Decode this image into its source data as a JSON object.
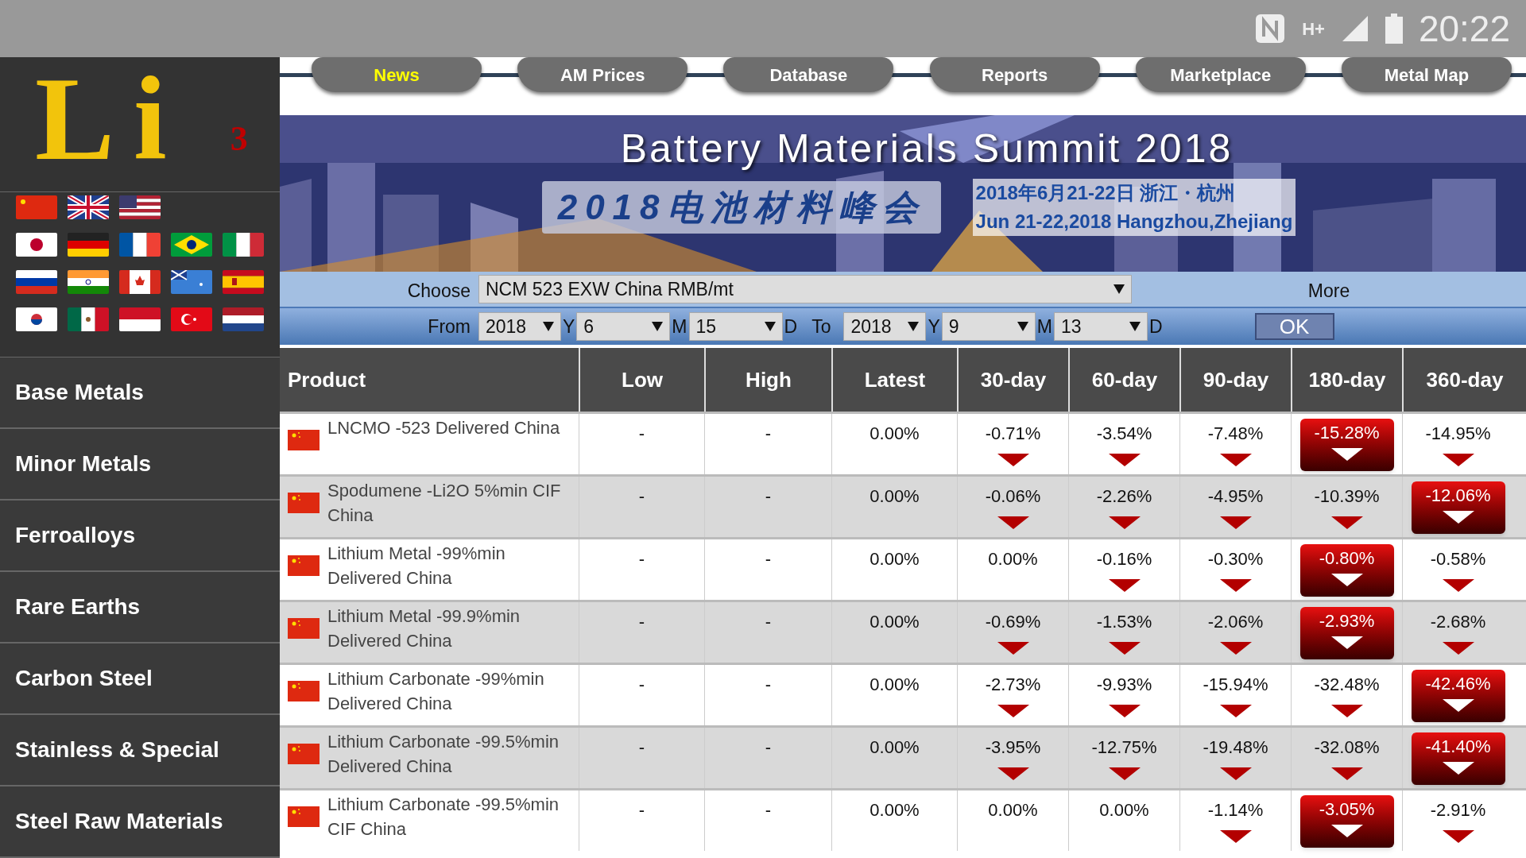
{
  "status_bar": {
    "network_type": "H+",
    "time": "20:22"
  },
  "logo": {
    "symbol": "Li",
    "number": "3"
  },
  "sidebar": {
    "items": [
      {
        "label": "Base Metals"
      },
      {
        "label": "Minor Metals"
      },
      {
        "label": "Ferroalloys"
      },
      {
        "label": "Rare Earths"
      },
      {
        "label": "Carbon Steel"
      },
      {
        "label": "Stainless & Special"
      },
      {
        "label": "Steel Raw Materials"
      }
    ]
  },
  "nav_tabs": [
    {
      "label": "News",
      "selected": true
    },
    {
      "label": "AM Prices",
      "selected": false
    },
    {
      "label": "Database",
      "selected": false
    },
    {
      "label": "Reports",
      "selected": false
    },
    {
      "label": "Marketplace",
      "selected": false
    },
    {
      "label": "Metal Map",
      "selected": false
    }
  ],
  "banner": {
    "title": "Battery Materials Summit 2018",
    "subtitle": "2018电池材料峰会",
    "date_cn": "2018年6月21-22日  浙江・杭州",
    "date_en": "Jun 21-22,2018  Hangzhou,Zhejiang"
  },
  "filter": {
    "choose_label": "Choose",
    "product_value": "NCM 523 EXW China RMB/mt",
    "more": "More",
    "from_label": "From",
    "to_label": "To",
    "from": [
      {
        "value": "2018",
        "unit": "Y"
      },
      {
        "value": "6",
        "unit": "M"
      },
      {
        "value": "15",
        "unit": "D"
      }
    ],
    "to": [
      {
        "value": "2018",
        "unit": "Y"
      },
      {
        "value": "9",
        "unit": "M"
      },
      {
        "value": "13",
        "unit": "D"
      }
    ],
    "ok": "OK"
  },
  "table": {
    "columns": [
      "Product",
      "Low",
      "High",
      "Latest",
      "30-day",
      "60-day",
      "90-day",
      "180-day",
      "360-day"
    ],
    "rows": [
      {
        "product": "LNCMO -523 Delivered China",
        "low": "-",
        "high": "-",
        "latest": "0.00%",
        "changes": [
          {
            "value": "-0.71%",
            "highlight": false,
            "down_arrow": true
          },
          {
            "value": "-3.54%",
            "highlight": false,
            "down_arrow": true
          },
          {
            "value": "-7.48%",
            "highlight": false,
            "down_arrow": true
          },
          {
            "value": "-15.28%",
            "highlight": true,
            "down_arrow": true
          },
          {
            "value": "-14.95%",
            "highlight": false,
            "down_arrow": true
          }
        ]
      },
      {
        "product": "Spodumene -Li2O 5%min CIF China",
        "low": "-",
        "high": "-",
        "latest": "0.00%",
        "changes": [
          {
            "value": "-0.06%",
            "highlight": false,
            "down_arrow": true
          },
          {
            "value": "-2.26%",
            "highlight": false,
            "down_arrow": true
          },
          {
            "value": "-4.95%",
            "highlight": false,
            "down_arrow": true
          },
          {
            "value": "-10.39%",
            "highlight": false,
            "down_arrow": true
          },
          {
            "value": "-12.06%",
            "highlight": true,
            "down_arrow": true
          }
        ]
      },
      {
        "product": "Lithium Metal -99%min Delivered China",
        "low": "-",
        "high": "-",
        "latest": "0.00%",
        "changes": [
          {
            "value": "0.00%",
            "highlight": false,
            "down_arrow": false
          },
          {
            "value": "-0.16%",
            "highlight": false,
            "down_arrow": true
          },
          {
            "value": "-0.30%",
            "highlight": false,
            "down_arrow": true
          },
          {
            "value": "-0.80%",
            "highlight": true,
            "down_arrow": true
          },
          {
            "value": "-0.58%",
            "highlight": false,
            "down_arrow": true
          }
        ]
      },
      {
        "product": "Lithium Metal -99.9%min Delivered China",
        "low": "-",
        "high": "-",
        "latest": "0.00%",
        "changes": [
          {
            "value": "-0.69%",
            "highlight": false,
            "down_arrow": true
          },
          {
            "value": "-1.53%",
            "highlight": false,
            "down_arrow": true
          },
          {
            "value": "-2.06%",
            "highlight": false,
            "down_arrow": true
          },
          {
            "value": "-2.93%",
            "highlight": true,
            "down_arrow": true
          },
          {
            "value": "-2.68%",
            "highlight": false,
            "down_arrow": true
          }
        ]
      },
      {
        "product": "Lithium Carbonate -99%min Delivered China",
        "low": "-",
        "high": "-",
        "latest": "0.00%",
        "changes": [
          {
            "value": "-2.73%",
            "highlight": false,
            "down_arrow": true
          },
          {
            "value": "-9.93%",
            "highlight": false,
            "down_arrow": true
          },
          {
            "value": "-15.94%",
            "highlight": false,
            "down_arrow": true
          },
          {
            "value": "-32.48%",
            "highlight": false,
            "down_arrow": true
          },
          {
            "value": "-42.46%",
            "highlight": true,
            "down_arrow": true
          }
        ]
      },
      {
        "product": "Lithium Carbonate -99.5%min Delivered China",
        "low": "-",
        "high": "-",
        "latest": "0.00%",
        "changes": [
          {
            "value": "-3.95%",
            "highlight": false,
            "down_arrow": true
          },
          {
            "value": "-12.75%",
            "highlight": false,
            "down_arrow": true
          },
          {
            "value": "-19.48%",
            "highlight": false,
            "down_arrow": true
          },
          {
            "value": "-32.08%",
            "highlight": false,
            "down_arrow": true
          },
          {
            "value": "-41.40%",
            "highlight": true,
            "down_arrow": true
          }
        ]
      },
      {
        "product": "Lithium Carbonate -99.5%min CIF China",
        "low": "-",
        "high": "-",
        "latest": "0.00%",
        "changes": [
          {
            "value": "0.00%",
            "highlight": false,
            "down_arrow": false
          },
          {
            "value": "0.00%",
            "highlight": false,
            "down_arrow": false
          },
          {
            "value": "-1.14%",
            "highlight": false,
            "down_arrow": true
          },
          {
            "value": "-3.05%",
            "highlight": true,
            "down_arrow": true
          },
          {
            "value": "-2.91%",
            "highlight": false,
            "down_arrow": true
          }
        ]
      }
    ]
  }
}
